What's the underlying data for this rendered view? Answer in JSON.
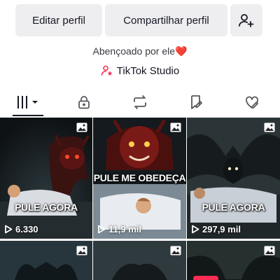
{
  "actions": {
    "edit_profile": "Editar perfil",
    "share_profile": "Compartilhar perfil"
  },
  "bio": {
    "text": "Abençoado por ele",
    "emoji": "❤️"
  },
  "studio": {
    "label": "TikTok Studio"
  },
  "tabs": [
    {
      "icon": "grid-icon",
      "active": true
    },
    {
      "icon": "lock-icon",
      "active": false
    },
    {
      "icon": "repost-icon",
      "active": false
    },
    {
      "icon": "bookmark-icon",
      "active": false
    },
    {
      "icon": "liked-heart-icon",
      "active": false
    }
  ],
  "posts": [
    {
      "caption": "PULE AGORA",
      "views": "6.330",
      "icon": "photo-icon"
    },
    {
      "caption": "PULE ME OBEDEÇA",
      "views": "11,9 mil",
      "icon": "photo-icon"
    },
    {
      "caption": "PULE AGORA",
      "views": "297,9 mil",
      "icon": "photo-icon"
    },
    {
      "caption": "",
      "views": "",
      "icon": "photo-icon"
    },
    {
      "caption": "",
      "views": "",
      "icon": "photo-icon"
    },
    {
      "caption": "",
      "views": "",
      "icon": "photo-icon"
    }
  ],
  "colors": {
    "accent": "#fe2c55",
    "heart": "#e6222a",
    "button_bg": "#eeeef0"
  }
}
